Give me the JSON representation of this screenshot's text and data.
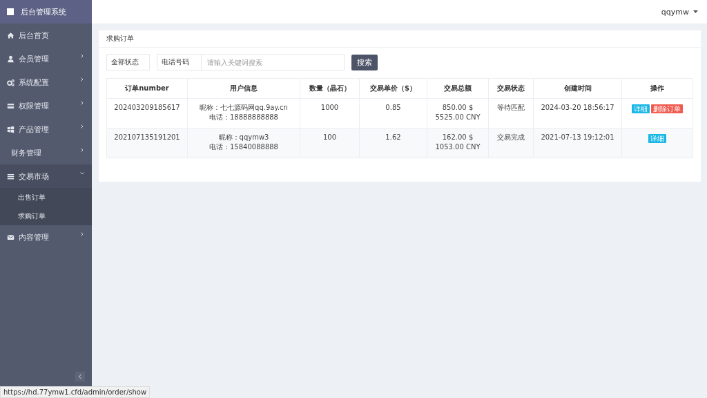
{
  "sidebar": {
    "title": "后台管理系统",
    "items": [
      {
        "label": "后台首页",
        "expanded": false,
        "has_children": false
      },
      {
        "label": "会员管理",
        "expanded": false,
        "has_children": true
      },
      {
        "label": "系统配置",
        "expanded": false,
        "has_children": true
      },
      {
        "label": "权限管理",
        "expanded": false,
        "has_children": true
      },
      {
        "label": "产品管理",
        "expanded": false,
        "has_children": true
      },
      {
        "label": "财务管理",
        "expanded": false,
        "has_children": true
      },
      {
        "label": "交易市场",
        "expanded": true,
        "has_children": true,
        "children": [
          {
            "label": "出售订单"
          },
          {
            "label": "求购订单"
          }
        ]
      },
      {
        "label": "内容管理",
        "expanded": false,
        "has_children": true
      }
    ]
  },
  "header": {
    "user": "qqymw"
  },
  "panel": {
    "title": "求购订单",
    "filters": {
      "status": "全部状态",
      "field": "电话号码",
      "placeholder": "请输入关键词搜索",
      "button": "搜索"
    },
    "table": {
      "columns": [
        "订单number",
        "用户信息",
        "数量（晶石）",
        "交易单价（$）",
        "交易总额",
        "交易状态",
        "创建时间",
        "操作"
      ],
      "rows": [
        {
          "order": "202403209185617",
          "user": [
            "昵称：七七源码网qq.9ay.cn",
            "电话：18888888888"
          ],
          "qty": "1000",
          "price": "0.85",
          "total": [
            "850.00 $",
            "5525.00 CNY"
          ],
          "status": "等待匹配",
          "created": "2024-03-20 18:56:17",
          "actions": [
            {
              "kind": "detail",
              "label": "详细"
            },
            {
              "kind": "delete",
              "label": "删除订单"
            }
          ]
        },
        {
          "order": "202107135191201",
          "user": [
            "昵称：qqymw3",
            "电话：15840088888"
          ],
          "qty": "100",
          "price": "1.62",
          "total": [
            "162.00 $",
            "1053.00 CNY"
          ],
          "status": "交易完成",
          "created": "2021-07-13 19:12:01",
          "actions": [
            {
              "kind": "detail",
              "label": "详细"
            }
          ]
        }
      ]
    }
  },
  "status_bar": {
    "url": "https://hd.77ymw1.cfd/admin/order/show"
  }
}
